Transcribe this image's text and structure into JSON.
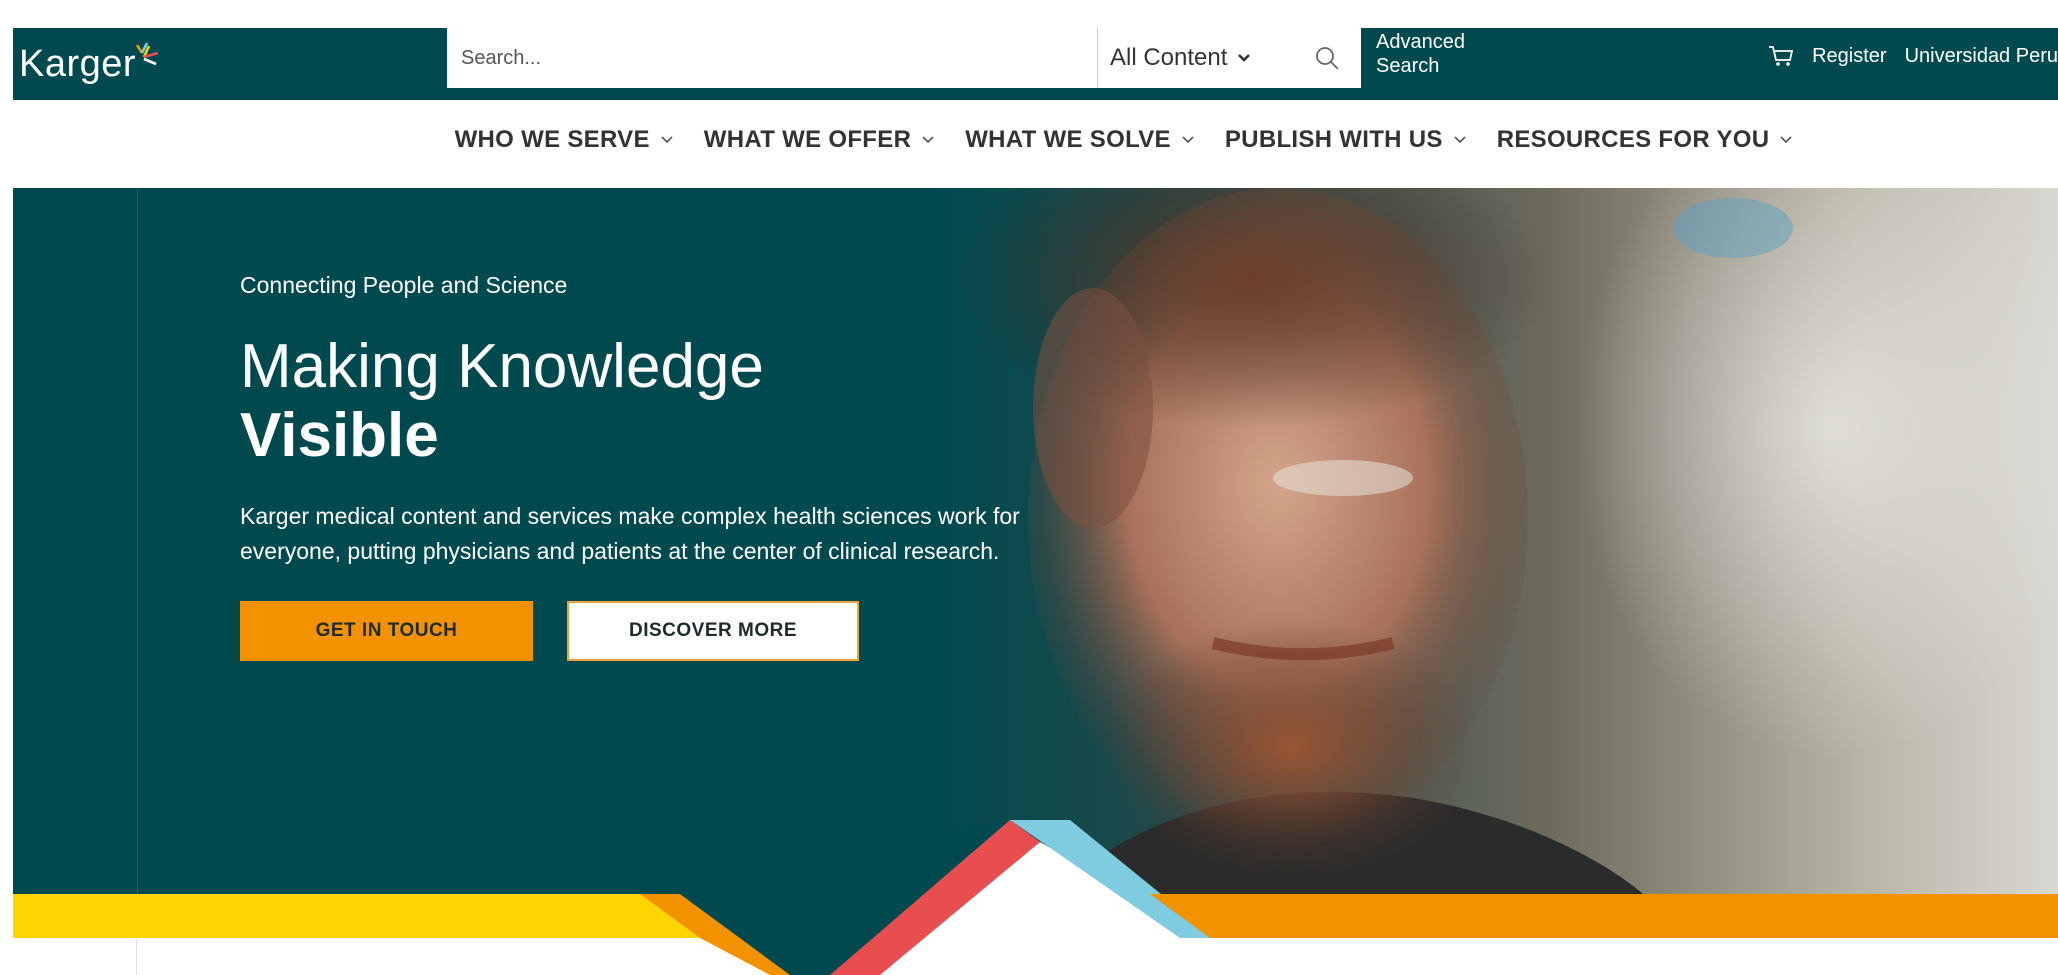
{
  "header": {
    "logo_text": "Karger",
    "search_placeholder": "Search...",
    "search_scope": "All Content",
    "advanced_search": "Advanced Search",
    "register": "Register",
    "institution": "Universidad Peru"
  },
  "nav": {
    "items": [
      {
        "label": "WHO WE SERVE"
      },
      {
        "label": "WHAT WE OFFER"
      },
      {
        "label": "WHAT WE SOLVE"
      },
      {
        "label": "PUBLISH WITH US"
      },
      {
        "label": "RESOURCES FOR YOU"
      }
    ]
  },
  "hero": {
    "eyebrow": "Connecting People and Science",
    "headline": "Making Knowledge",
    "headline_strong": "Visible",
    "lead": "Karger medical content and services make complex health sciences work for everyone, putting physicians and patients at the center of clinical research.",
    "cta_primary": "GET IN TOUCH",
    "cta_secondary": "DISCOVER MORE"
  },
  "colors": {
    "brand_teal": "#004a4f",
    "accent_orange": "#f39200",
    "accent_yellow": "#ffd500",
    "accent_red": "#e84e4f",
    "accent_blue": "#7fcbdf"
  },
  "icons": {
    "logo_mark": "karger-logo-mark",
    "search": "search-icon",
    "cart": "cart-icon",
    "chevron": "chevron-down-icon"
  }
}
